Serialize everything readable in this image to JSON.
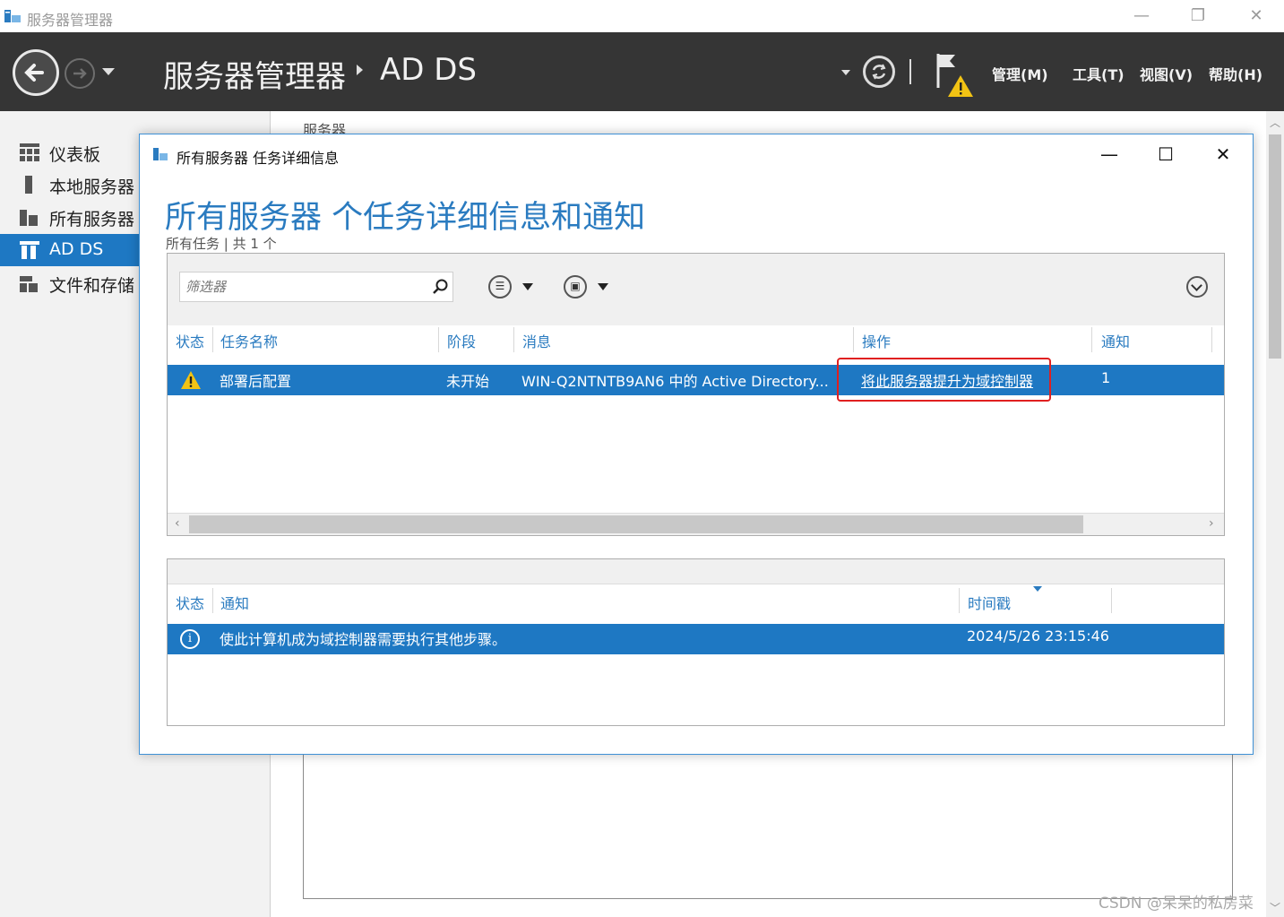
{
  "window": {
    "title": "服务器管理器",
    "minimize": "—",
    "restore": "❐",
    "close": "✕"
  },
  "header": {
    "breadcrumb_root": "服务器管理器",
    "breadcrumb_current": "AD DS",
    "menus": [
      "管理(M)",
      "工具(T)",
      "视图(V)",
      "帮助(H)"
    ]
  },
  "sidebar": {
    "items": [
      {
        "label": "仪表板",
        "icon": "dashboard-icon"
      },
      {
        "label": "本地服务器",
        "icon": "local-server-icon"
      },
      {
        "label": "所有服务器",
        "icon": "all-servers-icon"
      },
      {
        "label": "AD DS",
        "icon": "ad-ds-icon",
        "active": true
      },
      {
        "label": "文件和存储",
        "icon": "file-storage-icon"
      }
    ]
  },
  "background": {
    "tile_title": "服务器"
  },
  "dialog": {
    "title": "所有服务器 任务详细信息",
    "heading": "所有服务器 个任务详细信息和通知",
    "subtitle": "所有任务 | 共 1 个",
    "filter_placeholder": "筛选器",
    "task_columns": [
      "状态",
      "任务名称",
      "阶段",
      "消息",
      "操作",
      "通知"
    ],
    "tasks": [
      {
        "status_icon": "warning-icon",
        "name": "部署后配置",
        "stage": "未开始",
        "message": "WIN-Q2NTNTB9AN6 中的 Active Directory...",
        "action": "将此服务器提升为域控制器",
        "notifications": "1"
      }
    ],
    "notification_columns": [
      "状态",
      "通知",
      "时间戳"
    ],
    "notifications": [
      {
        "status_icon": "info-icon",
        "text": "使此计算机成为域控制器需要执行其他步骤。",
        "timestamp": "2024/5/26 23:15:46"
      }
    ]
  },
  "watermark": "CSDN @呆呆的私房菜",
  "colors": {
    "accent": "#1e78c3",
    "heading": "#2a7bc0",
    "header_bg": "#353535",
    "highlight": "#e02020"
  }
}
